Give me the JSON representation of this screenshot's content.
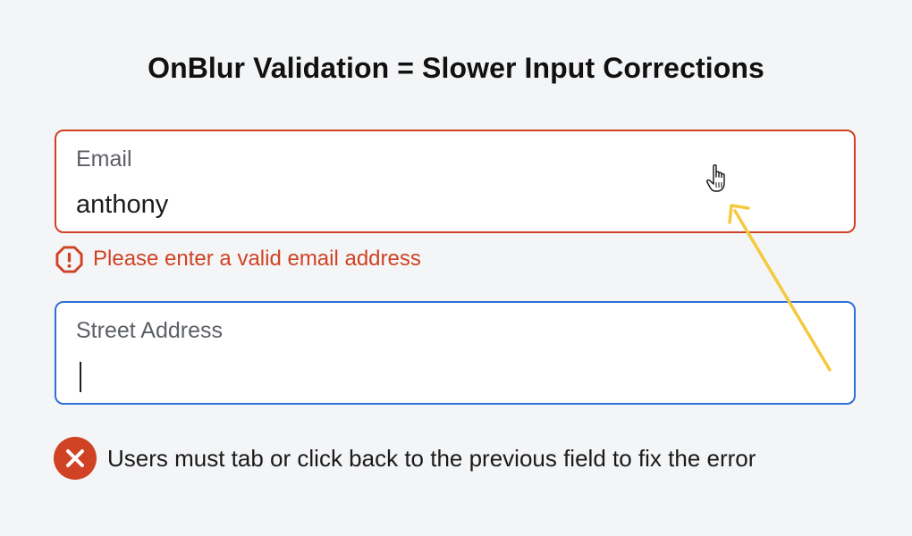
{
  "title": "OnBlur Validation = Slower Input Corrections",
  "email_field": {
    "label": "Email",
    "value": "anthony",
    "state": "error"
  },
  "email_error": {
    "message": "Please enter a valid email address",
    "icon": "alert-octagon-icon"
  },
  "address_field": {
    "label": "Street Address",
    "value": "",
    "state": "focused"
  },
  "note": {
    "text": "Users must tab or click back to the previous field to fix the error",
    "icon": "x-circle-icon"
  },
  "colors": {
    "error": "#cf4324",
    "focus": "#2f6fd6",
    "arrow": "#f5c93e",
    "background": "#f4f5f7"
  }
}
